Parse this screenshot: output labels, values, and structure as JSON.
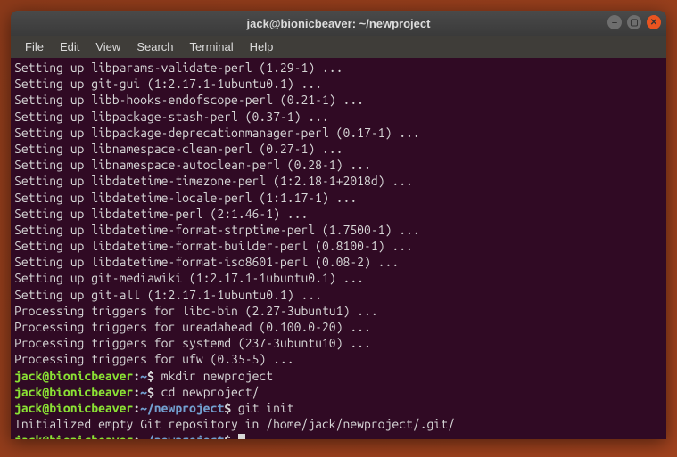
{
  "window": {
    "title": "jack@bionicbeaver: ~/newproject"
  },
  "menu": {
    "file": "File",
    "edit": "Edit",
    "view": "View",
    "search": "Search",
    "terminal": "Terminal",
    "help": "Help"
  },
  "output_lines": [
    "Setting up libparams-validate-perl (1.29-1) ...",
    "Setting up git-gui (1:2.17.1-1ubuntu0.1) ...",
    "Setting up libb-hooks-endofscope-perl (0.21-1) ...",
    "Setting up libpackage-stash-perl (0.37-1) ...",
    "Setting up libpackage-deprecationmanager-perl (0.17-1) ...",
    "Setting up libnamespace-clean-perl (0.27-1) ...",
    "Setting up libnamespace-autoclean-perl (0.28-1) ...",
    "Setting up libdatetime-timezone-perl (1:2.18-1+2018d) ...",
    "Setting up libdatetime-locale-perl (1:1.17-1) ...",
    "Setting up libdatetime-perl (2:1.46-1) ...",
    "Setting up libdatetime-format-strptime-perl (1.7500-1) ...",
    "Setting up libdatetime-format-builder-perl (0.8100-1) ...",
    "Setting up libdatetime-format-iso8601-perl (0.08-2) ...",
    "Setting up git-mediawiki (1:2.17.1-1ubuntu0.1) ...",
    "Setting up git-all (1:2.17.1-1ubuntu0.1) ...",
    "Processing triggers for libc-bin (2.27-3ubuntu1) ...",
    "Processing triggers for ureadahead (0.100.0-20) ...",
    "Processing triggers for systemd (237-3ubuntu10) ...",
    "Processing triggers for ufw (0.35-5) ..."
  ],
  "prompts": [
    {
      "user": "jack@bionicbeaver",
      "path": "~",
      "cmd": "mkdir newproject"
    },
    {
      "user": "jack@bionicbeaver",
      "path": "~",
      "cmd": "cd newproject/"
    },
    {
      "user": "jack@bionicbeaver",
      "path": "~/newproject",
      "cmd": "git init"
    }
  ],
  "git_output": "Initialized empty Git repository in /home/jack/newproject/.git/",
  "final_prompt": {
    "user": "jack@bionicbeaver",
    "path": "~/newproject"
  }
}
